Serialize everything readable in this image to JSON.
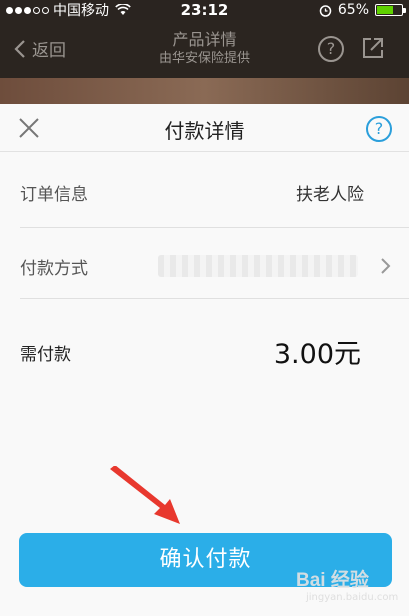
{
  "status_bar": {
    "carrier": "中国移动",
    "time": "23:12",
    "battery_percent": "65%",
    "battery_level": 0.65,
    "battery_color": "#5fd100"
  },
  "nav_bar": {
    "back_label": "返回",
    "title": "产品详情",
    "subtitle": "由华安保险提供",
    "help_glyph": "?"
  },
  "sheet": {
    "title": "付款详情",
    "help_glyph": "?",
    "order_info_label": "订单信息",
    "order_info_value": "扶老人险",
    "payment_method_label": "付款方式",
    "amount_due_label": "需付款",
    "amount_due_value": "3.00元"
  },
  "confirm_button_label": "确认付款",
  "watermark": {
    "logo_text": "Bai 经验",
    "url": "jingyan.baidu.com"
  },
  "colors": {
    "accent": "#2baee8",
    "help_icon": "#2b9fdb",
    "arrow": "#e8382e"
  }
}
